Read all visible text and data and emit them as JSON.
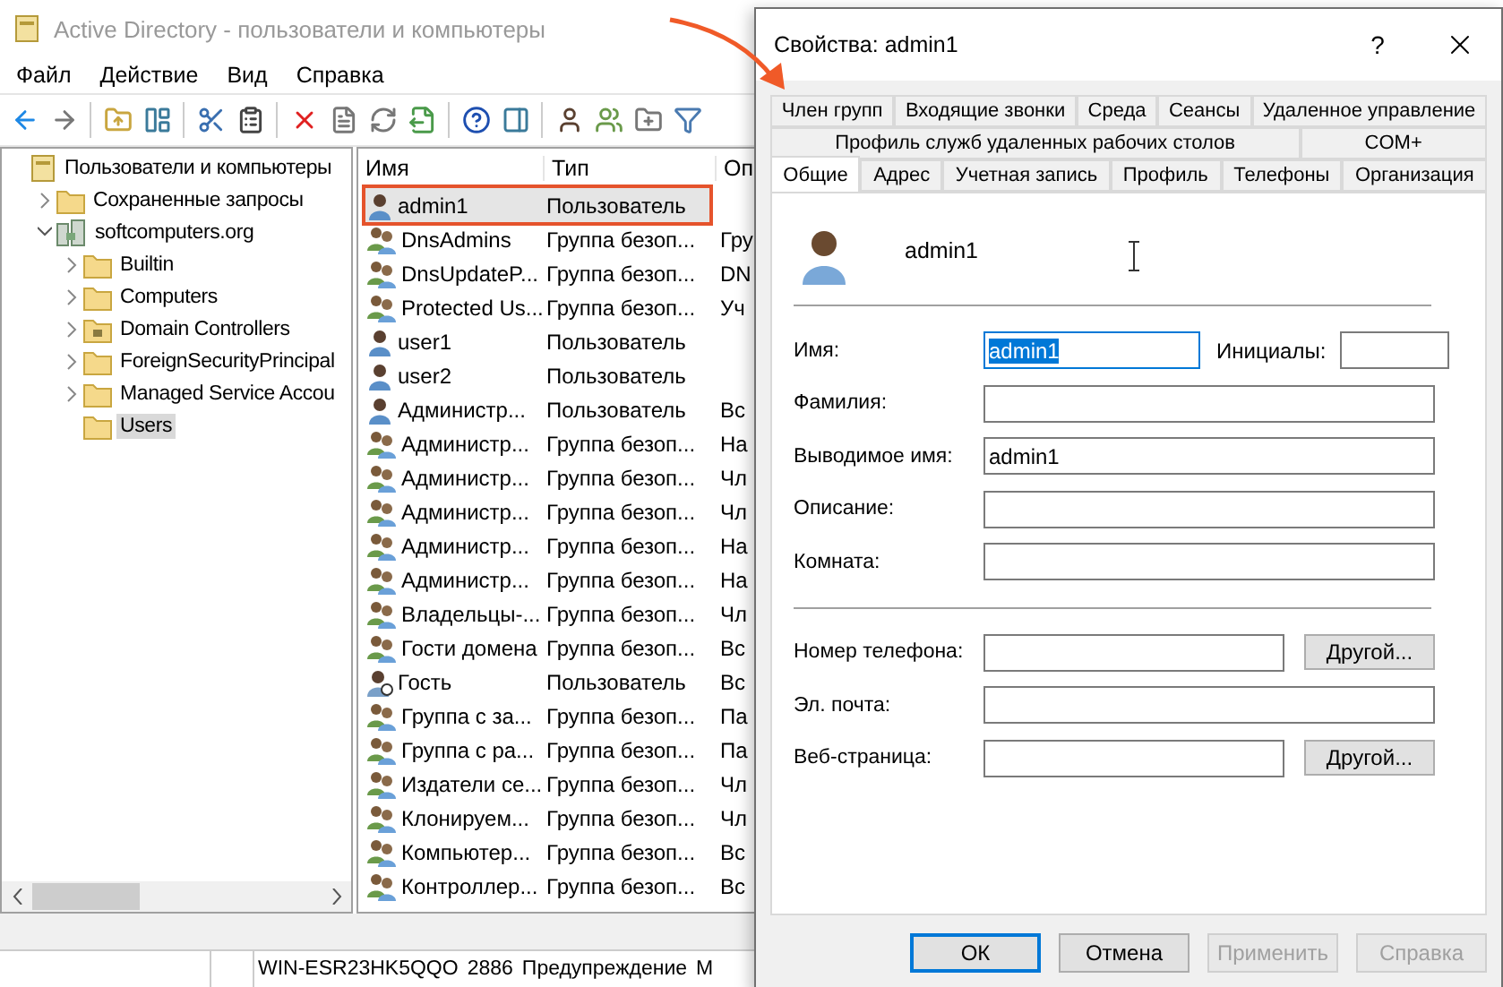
{
  "main_window": {
    "title": "Active Directory - пользователи и компьютеры",
    "menu": [
      {
        "label": "Файл"
      },
      {
        "label": "Действие"
      },
      {
        "label": "Вид"
      },
      {
        "label": "Справка"
      }
    ],
    "tree": [
      {
        "label": "Пользователи и компьютеры",
        "kind": "root",
        "selected": false,
        "children": [
          {
            "label": "Сохраненные запросы",
            "kind": "folder",
            "expanded": false,
            "selected": false
          },
          {
            "label": "softcomputers.org",
            "kind": "domain",
            "expanded": true,
            "selected": false,
            "children": [
              {
                "label": "Builtin",
                "kind": "folder",
                "expanded": false,
                "selected": false
              },
              {
                "label": "Computers",
                "kind": "folder",
                "expanded": false,
                "selected": false
              },
              {
                "label": "Domain Controllers",
                "kind": "ou",
                "expanded": false,
                "selected": false
              },
              {
                "label": "ForeignSecurityPrincipal",
                "kind": "folder",
                "expanded": false,
                "selected": false
              },
              {
                "label": "Managed Service Accou",
                "kind": "folder",
                "expanded": false,
                "selected": false
              },
              {
                "label": "Users",
                "kind": "folder",
                "selected": true
              }
            ]
          }
        ]
      }
    ],
    "table": {
      "columns": [
        "Имя",
        "Тип",
        "Оп"
      ],
      "rows": [
        {
          "kind": "user",
          "cells": [
            "admin1",
            "Пользователь",
            ""
          ],
          "selected": true,
          "annotated": true
        },
        {
          "kind": "group",
          "cells": [
            "DnsAdmins",
            "Группа безоп...",
            "Гру"
          ],
          "selected": false,
          "annotated": false
        },
        {
          "kind": "group",
          "cells": [
            "DnsUpdateP...",
            "Группа безоп...",
            "DN"
          ],
          "selected": false,
          "annotated": false
        },
        {
          "kind": "group",
          "cells": [
            "Protected Us...",
            "Группа безоп...",
            "Уч"
          ],
          "selected": false,
          "annotated": false
        },
        {
          "kind": "user",
          "cells": [
            "user1",
            "Пользователь",
            ""
          ],
          "selected": false,
          "annotated": false
        },
        {
          "kind": "user",
          "cells": [
            "user2",
            "Пользователь",
            ""
          ],
          "selected": false,
          "annotated": false
        },
        {
          "kind": "user",
          "cells": [
            "Администр...",
            "Пользователь",
            "Вс"
          ],
          "selected": false,
          "annotated": false
        },
        {
          "kind": "group",
          "cells": [
            "Администр...",
            "Группа безоп...",
            "На"
          ],
          "selected": false,
          "annotated": false
        },
        {
          "kind": "group",
          "cells": [
            "Администр...",
            "Группа безоп...",
            "Чл"
          ],
          "selected": false,
          "annotated": false
        },
        {
          "kind": "group",
          "cells": [
            "Администр...",
            "Группа безоп...",
            "Чл"
          ],
          "selected": false,
          "annotated": false
        },
        {
          "kind": "group",
          "cells": [
            "Администр...",
            "Группа безоп...",
            "На"
          ],
          "selected": false,
          "annotated": false
        },
        {
          "kind": "group",
          "cells": [
            "Администр...",
            "Группа безоп...",
            "На"
          ],
          "selected": false,
          "annotated": false
        },
        {
          "kind": "group",
          "cells": [
            "Владельцы-...",
            "Группа безоп...",
            "Чл"
          ],
          "selected": false,
          "annotated": false
        },
        {
          "kind": "group",
          "cells": [
            "Гости домена",
            "Группа безоп...",
            "Вс"
          ],
          "selected": false,
          "annotated": false
        },
        {
          "kind": "guest",
          "cells": [
            "Гость",
            "Пользователь",
            "Вс"
          ],
          "selected": false,
          "annotated": false
        },
        {
          "kind": "group",
          "cells": [
            "Группа с за...",
            "Группа безоп...",
            "Па"
          ],
          "selected": false,
          "annotated": false
        },
        {
          "kind": "group",
          "cells": [
            "Группа с ра...",
            "Группа безоп...",
            "Па"
          ],
          "selected": false,
          "annotated": false
        },
        {
          "kind": "group",
          "cells": [
            "Издатели се...",
            "Группа безоп...",
            "Чл"
          ],
          "selected": false,
          "annotated": false
        },
        {
          "kind": "group",
          "cells": [
            "Клонируем...",
            "Группа безоп...",
            "Чл"
          ],
          "selected": false,
          "annotated": false
        },
        {
          "kind": "group",
          "cells": [
            "Компьютер...",
            "Группа безоп...",
            "Вс"
          ],
          "selected": false,
          "annotated": false
        },
        {
          "kind": "group",
          "cells": [
            "Контроллер...",
            "Группа безоп...",
            "Вс"
          ],
          "selected": false,
          "annotated": false
        }
      ]
    },
    "status_bar": [
      "WIN-ESR23HK5QQO",
      "2886",
      "Предупреждение",
      "M"
    ]
  },
  "dialog": {
    "title": "Свойства: admin1",
    "help": "?",
    "tab_rows": [
      [
        {
          "label": "Член групп",
          "selected": false
        },
        {
          "label": "Входящие звонки",
          "selected": false
        },
        {
          "label": "Среда",
          "selected": false
        },
        {
          "label": "Сеансы",
          "selected": false
        },
        {
          "label": "Удаленное управление",
          "selected": false
        }
      ],
      [
        {
          "label": "Профиль служб удаленных рабочих столов",
          "selected": false
        },
        {
          "label": "COM+",
          "selected": false
        }
      ],
      [
        {
          "label": "Общие",
          "selected": true
        },
        {
          "label": "Адрес",
          "selected": false
        },
        {
          "label": "Учетная запись",
          "selected": false
        },
        {
          "label": "Профиль",
          "selected": false
        },
        {
          "label": "Телефоны",
          "selected": false
        },
        {
          "label": "Организация",
          "selected": false
        }
      ]
    ],
    "user_name": "admin1",
    "identity_fields": [
      {
        "kind": "name",
        "label": "Имя:",
        "value": "admin1",
        "value_selected": true,
        "side_label": "Инициалы:"
      },
      {
        "kind": "text",
        "label": "Фамилия:"
      },
      {
        "kind": "text",
        "label": "Выводимое имя:",
        "value": "admin1",
        "value_selected": false
      },
      {
        "kind": "text",
        "label": "Описание:"
      },
      {
        "kind": "text",
        "label": "Комната:"
      }
    ],
    "contact_fields": [
      {
        "kind": "with_button",
        "label": "Номер телефона:",
        "button": "Другой..."
      },
      {
        "kind": "text",
        "label": "Эл. почта:"
      },
      {
        "kind": "with_button",
        "label": "Веб-страница:",
        "button": "Другой..."
      }
    ],
    "buttons": [
      {
        "label": "ОК",
        "default": true,
        "disabled": false
      },
      {
        "label": "Отмена",
        "default": false,
        "disabled": false
      },
      {
        "label": "Применить",
        "default": false,
        "disabled": true
      },
      {
        "label": "Справка",
        "default": false,
        "disabled": true
      }
    ]
  }
}
